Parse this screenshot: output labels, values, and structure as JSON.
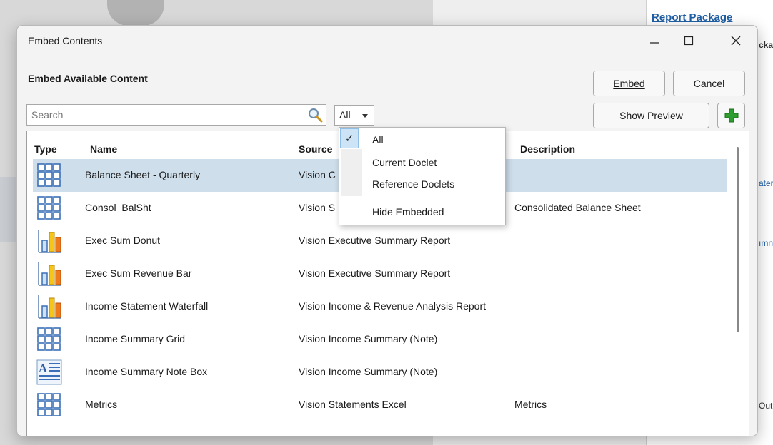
{
  "background": {
    "panel_title": "Report Package",
    "clipped_1": "cka",
    "clipped_2": "ater",
    "clipped_3": "ımn",
    "clipped_4": "Out"
  },
  "dialog": {
    "title": "Embed Contents",
    "subheading": "Embed Available Content",
    "embed_label": "Embed",
    "cancel_label": "Cancel",
    "show_preview_label": "Show Preview",
    "search_placeholder": "Search",
    "filter_value": "All"
  },
  "table": {
    "columns": [
      "Type",
      "Name",
      "Source",
      "Description"
    ],
    "rows": [
      {
        "type_icon": "grid-icon",
        "name": "Balance Sheet - Quarterly",
        "source": "Vision C",
        "description": "",
        "selected": true
      },
      {
        "type_icon": "grid-icon",
        "name": "Consol_BalSht",
        "source": "Vision S",
        "description": "Consolidated Balance Sheet"
      },
      {
        "type_icon": "bar-chart-icon",
        "name": "Exec Sum Donut",
        "source": "Vision Executive Summary Report",
        "description": ""
      },
      {
        "type_icon": "bar-chart-icon",
        "name": "Exec Sum Revenue Bar",
        "source": "Vision Executive Summary Report",
        "description": ""
      },
      {
        "type_icon": "bar-chart-icon",
        "name": "Income Statement Waterfall",
        "source": "Vision Income & Revenue Analysis Report",
        "description": ""
      },
      {
        "type_icon": "grid-icon",
        "name": "Income Summary Grid",
        "source": "Vision Income Summary (Note)",
        "description": ""
      },
      {
        "type_icon": "text-box-icon",
        "name": "Income Summary Note Box",
        "source": "Vision Income Summary (Note)",
        "description": ""
      },
      {
        "type_icon": "grid-icon",
        "name": "Metrics",
        "source": "Vision Statements Excel",
        "description": "Metrics"
      }
    ]
  },
  "filter_menu": {
    "items": [
      "All",
      "Current Doclet",
      "Reference Doclets",
      "Hide Embedded"
    ],
    "checked": "All"
  },
  "colors": {
    "selected_row": "#cfdeeb",
    "accent_green": "#2e9e2e",
    "link_blue": "#1f5fa6"
  }
}
